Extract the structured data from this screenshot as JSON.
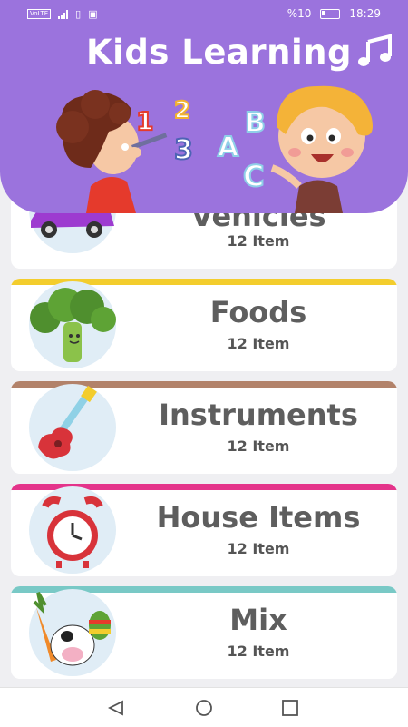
{
  "status_bar": {
    "volte": "VoLTE",
    "battery": "%10",
    "time": "18:29"
  },
  "header": {
    "title": "Kids Learning",
    "music_icon": "music-note-icon",
    "background_color": "#9b73dd"
  },
  "categories": [
    {
      "name": "Vehicles",
      "count": "12 Item",
      "icon": "car-icon",
      "band_color": "#ffffff"
    },
    {
      "name": "Foods",
      "count": "12 Item",
      "icon": "broccoli-icon",
      "band_color": "#f3cd2d"
    },
    {
      "name": "Instruments",
      "count": "12 Item",
      "icon": "guitar-icon",
      "band_color": "#b2826a"
    },
    {
      "name": "House Items",
      "count": "12 Item",
      "icon": "alarm-clock-icon",
      "band_color": "#e4338a"
    },
    {
      "name": "Mix",
      "count": "12 Item",
      "icon": "mixed-items-icon",
      "band_color": "#79c9c6"
    }
  ],
  "nav": {
    "back": "back-icon",
    "home": "home-icon",
    "recents": "recents-icon"
  }
}
